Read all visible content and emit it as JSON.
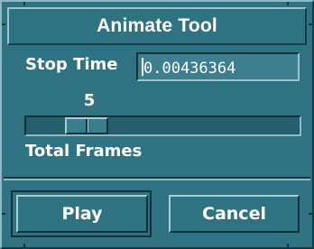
{
  "window": {
    "title": "Animate Tool"
  },
  "stop_time": {
    "label": "Stop Time",
    "value": "0.00436364"
  },
  "total_frames": {
    "label": "Total Frames",
    "value": "5"
  },
  "buttons": {
    "play": "Play",
    "cancel": "Cancel"
  },
  "colors": {
    "background": "#2f7383",
    "text": "#ffffff",
    "field": "#3e7f8f"
  }
}
